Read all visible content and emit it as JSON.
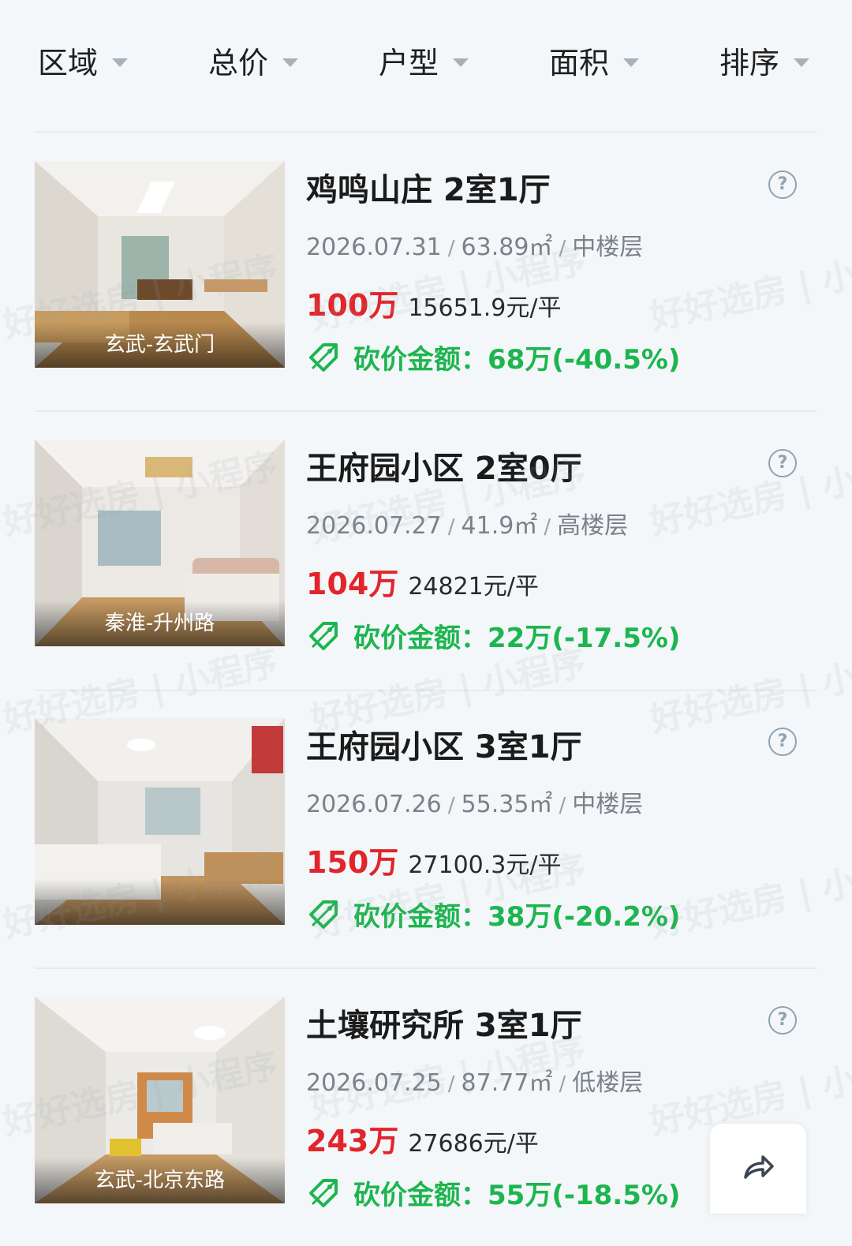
{
  "filters": [
    {
      "label": "区域"
    },
    {
      "label": "总价"
    },
    {
      "label": "户型"
    },
    {
      "label": "面积"
    },
    {
      "label": "排序"
    }
  ],
  "watermark": "好好选房 | 小程序",
  "listings": [
    {
      "title": "鸡鸣山庄 2室1厅",
      "date": "2026.07.31",
      "area": "63.89㎡",
      "floor": "中楼层",
      "price": "100万",
      "unit_price": "15651.9元/平",
      "cut_label": "砍价金额：",
      "cut_value": "68万(-40.5%)",
      "location": "玄武-玄武门"
    },
    {
      "title": "王府园小区 2室0厅",
      "date": "2026.07.27",
      "area": "41.9㎡",
      "floor": "高楼层",
      "price": "104万",
      "unit_price": "24821元/平",
      "cut_label": "砍价金额：",
      "cut_value": "22万(-17.5%)",
      "location": "秦淮-升州路"
    },
    {
      "title": "王府园小区 3室1厅",
      "date": "2026.07.26",
      "area": "55.35㎡",
      "floor": "中楼层",
      "price": "150万",
      "unit_price": "27100.3元/平",
      "cut_label": "砍价金额：",
      "cut_value": "38万(-20.2%)",
      "location": ""
    },
    {
      "title": "土壤研究所 3室1厅",
      "date": "2026.07.25",
      "area": "87.77㎡",
      "floor": "低楼层",
      "price": "243万",
      "unit_price": "27686元/平",
      "cut_label": "砍价金额：",
      "cut_value": "55万(-18.5%)",
      "location": "玄武-北京东路"
    }
  ],
  "colors": {
    "price": "#e1252b",
    "cut": "#1db54f",
    "background": "#f4f7f9"
  },
  "icons": {
    "help": "question-circle-icon",
    "tag": "price-tag-icon",
    "share": "share-arrow-icon"
  }
}
